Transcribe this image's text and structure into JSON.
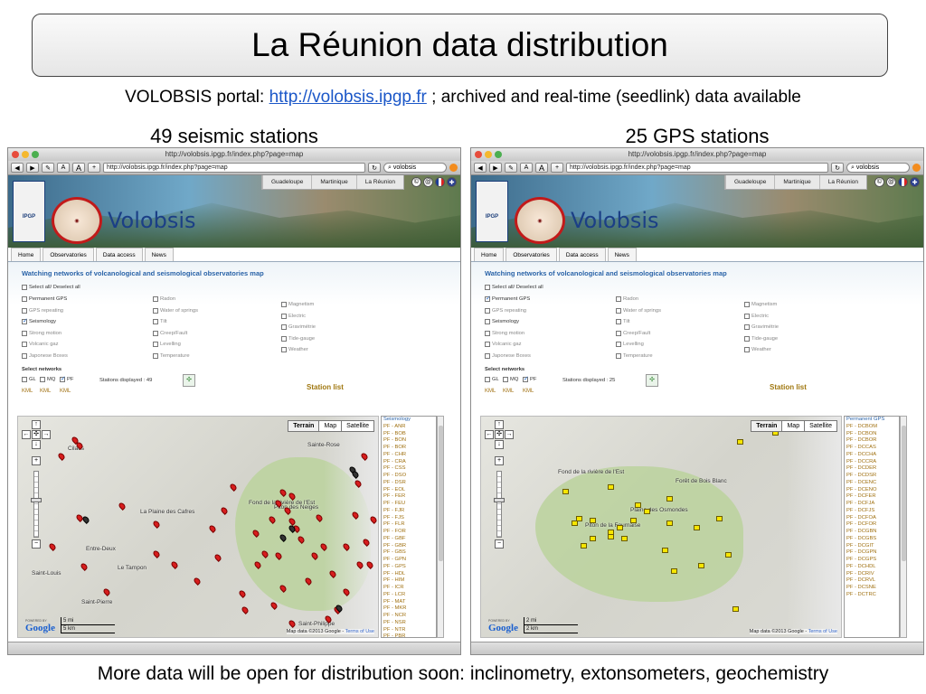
{
  "slide": {
    "title": "La Réunion data distribution",
    "subtitle_prefix": "VOLOBSIS portal: ",
    "subtitle_link": "http://volobsis.ipgp.fr",
    "subtitle_suffix": " ; archived and real-time (seedlink) data available",
    "left_heading": "49 seismic stations",
    "right_heading": "25 GPS stations",
    "footer": "More data will be open for distribution soon: inclinometry, extonsometers, geochemistry"
  },
  "browser": {
    "window_title": "http://volobsis.ipgp.fr/index.php?page=map",
    "url": "http://volobsis.ipgp.fr/index.php?page=map",
    "search": "volobsis",
    "btn_text_small": "A",
    "btn_text_large": "A",
    "btn_plus": "+"
  },
  "site": {
    "brand": "Volobsis",
    "logo_text": "IPGP",
    "regions": [
      "Guadeloupe",
      "Martinique",
      "La Réunion"
    ],
    "nav": [
      "Home",
      "Observatories",
      "Data access",
      "News"
    ],
    "page_heading": "Watching networks of volcanological and seismological observatories map",
    "select_all": "Select all/ Deselect all",
    "col1": [
      "Permanent GPS",
      "GPS repeating",
      "Seismology",
      "Strong motion",
      "Volcanic gaz",
      "Japonese Boxes"
    ],
    "col2": [
      "Radon",
      "Water of springs",
      "Tilt",
      "Creep/Fault",
      "Levelling",
      "Temperature"
    ],
    "col3": [
      "Magnetism",
      "Electric",
      "Gravimétrie",
      "Tide-gauge",
      "Weather"
    ],
    "select_networks": "Select networks",
    "networks": [
      "GL",
      "MQ",
      "PF"
    ],
    "kml": [
      "KML",
      "KML",
      "KML"
    ],
    "station_list_label": "Station list",
    "map_types": [
      "Terrain",
      "Map",
      "Satellite"
    ],
    "map_data": "Map data ©2013 Google - ",
    "terms": "Terms of Use",
    "google": "Google",
    "powered": "POWERED BY"
  },
  "left": {
    "stations_displayed": "Stations displayed : 49",
    "list_header": "Seismology",
    "scale": [
      "5 mi",
      "5 km"
    ],
    "stations": [
      "PF - ANR",
      "PF - BOB",
      "PF - BON",
      "PF - BOR",
      "PF - CHR",
      "PF - CRA",
      "PF - CSS",
      "PF - DSO",
      "PF - DSR",
      "PF - EOL",
      "PF - FER",
      "PF - FEU",
      "PF - FJR",
      "PF - FJS",
      "PF - FLR",
      "PF - FOR",
      "PF - GBF",
      "PF - GBR",
      "PF - GBS",
      "PF - GPN",
      "PF - GPS",
      "PF - HDL",
      "PF - HIM",
      "PF - ICR",
      "PF - LCR",
      "PF - MAT",
      "PF - MKR",
      "PF - NCR",
      "PF - NSR",
      "PF - NTR",
      "PF - PBR",
      "PF - PCR"
    ],
    "places": [
      "Cilaos",
      "Sainte-Rose",
      "Fond de la rivière de l'Est",
      "Piton des Neiges",
      "La Plaine des Cafres",
      "Entre-Deux",
      "Saint-Louis",
      "Le Tampon",
      "Saint-Pierre",
      "Saint-Philippe"
    ]
  },
  "right": {
    "stations_displayed": "Stations displayed : 25",
    "list_header": "Permanent GPS",
    "scale": [
      "2 mi",
      "2 km"
    ],
    "stations": [
      "PF - DCBOM",
      "PF - DCBON",
      "PF - DCBOR",
      "PF - DCCAS",
      "PF - DCCHA",
      "PF - DCCRA",
      "PF - DCDER",
      "PF - DCDSR",
      "PF - DCENC",
      "PF - DCENO",
      "PF - DCFER",
      "PF - DCFJA",
      "PF - DCFJS",
      "PF - DCFOA",
      "PF - DCFOR",
      "PF - DCGBN",
      "PF - DCGBS",
      "PF - DCGIT",
      "PF - DCGPN",
      "PF - DCGPS",
      "PF - DCHDL",
      "PF - DCRIV",
      "PF - DCRVL",
      "PF - DCSNE",
      "PF - DCTRC"
    ],
    "places": [
      "Fond de la rivière de l'Est",
      "Forêt de Bois Blanc",
      "Plaine des Osmondes",
      "Piton de la Fournaise"
    ]
  }
}
